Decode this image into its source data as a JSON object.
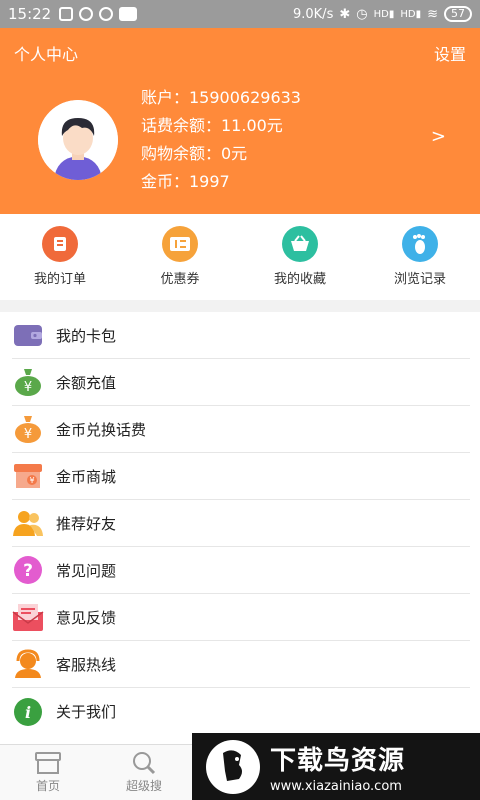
{
  "status_bar": {
    "time": "15:22",
    "speed": "9.0K/s",
    "battery": "57",
    "net_labels": [
      "HD",
      "HD"
    ]
  },
  "header": {
    "title": "个人中心",
    "settings": "设置",
    "arrow": ">",
    "account_rows": [
      "账户：15900629633",
      "话费余额：11.00元",
      "购物余额：0元",
      "金币：1997"
    ]
  },
  "quick_actions": [
    {
      "label": "我的订单",
      "icon": "order-icon",
      "color": "#f06a3a"
    },
    {
      "label": "优惠券",
      "icon": "coupon-icon",
      "color": "#f6a23a"
    },
    {
      "label": "我的收藏",
      "icon": "basket-icon",
      "color": "#2dbfa0"
    },
    {
      "label": "浏览记录",
      "icon": "footprint-icon",
      "color": "#3fb1e8"
    }
  ],
  "menu_items": [
    {
      "label": "我的卡包",
      "icon": "wallet-icon",
      "color": "#7d6fb7"
    },
    {
      "label": "余额充值",
      "icon": "money-bag-icon",
      "color": "#5aa84a"
    },
    {
      "label": "金币兑换话费",
      "icon": "coin-bag-icon",
      "color": "#f59a3a"
    },
    {
      "label": "金币商城",
      "icon": "store-icon",
      "color": "#f47a4a"
    },
    {
      "label": "推荐好友",
      "icon": "friends-icon",
      "color": "#f6a31f"
    },
    {
      "label": "常见问题",
      "icon": "question-icon",
      "color": "#e35ccf"
    },
    {
      "label": "意见反馈",
      "icon": "feedback-icon",
      "color": "#ec4f5f"
    },
    {
      "label": "客服热线",
      "icon": "headset-icon",
      "color": "#f3891d"
    },
    {
      "label": "关于我们",
      "icon": "info-icon",
      "color": "#3aa040"
    }
  ],
  "bottom_nav": [
    {
      "label": "首页",
      "icon": "home-store-icon"
    },
    {
      "label": "超级搜",
      "icon": "search-icon"
    }
  ],
  "watermark": {
    "title": "下载鸟资源",
    "url": "www.xiazainiao.com"
  }
}
